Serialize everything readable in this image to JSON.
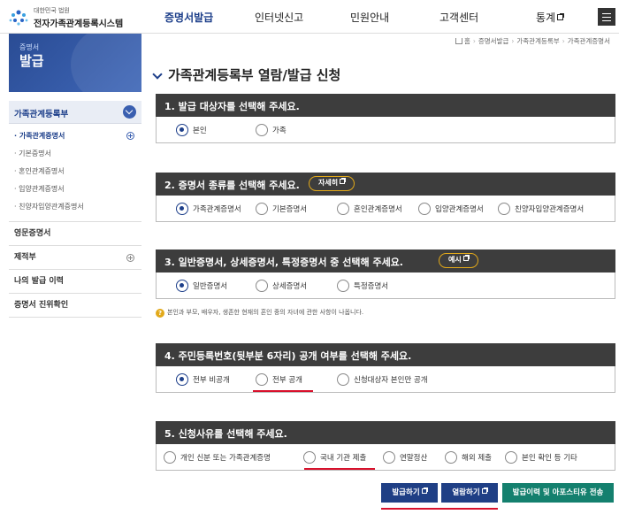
{
  "header": {
    "logo_sub": "대한민국 법원",
    "logo_main": "전자가족관계등록시스템",
    "logo_icon": "court-emblem-icon",
    "nav": [
      {
        "label": "증명서발급",
        "active": true,
        "external": false
      },
      {
        "label": "인터넷신고",
        "active": false,
        "external": false
      },
      {
        "label": "민원안내",
        "active": false,
        "external": false
      },
      {
        "label": "고객센터",
        "active": false,
        "external": false
      },
      {
        "label": "통계",
        "active": false,
        "external": true
      }
    ],
    "menu_icon": "hamburger-icon"
  },
  "sidebar": {
    "banner_small": "증명서",
    "banner_big": "발급",
    "section_title": "가족관계등록부",
    "sub_items": [
      {
        "label": "가족관계증명서",
        "active": true
      },
      {
        "label": "기본증명서",
        "active": false
      },
      {
        "label": "혼인관계증명서",
        "active": false
      },
      {
        "label": "입양관계증명서",
        "active": false
      },
      {
        "label": "친양자입양관계증명서",
        "active": false
      }
    ],
    "menus": [
      {
        "label": "영문증명서",
        "expandable": false
      },
      {
        "label": "제적부",
        "expandable": true
      },
      {
        "label": "나의 발급 이력",
        "expandable": false
      },
      {
        "label": "증명서 진위확인",
        "expandable": false
      }
    ]
  },
  "breadcrumb": [
    "홈",
    "증명서발급",
    "가족관계등록부",
    "가족관계증명서"
  ],
  "page_title": "가족관계등록부 열람/발급 신청",
  "sections": [
    {
      "title": "1. 발급 대상자를 선택해 주세요.",
      "pill": "",
      "options": [
        {
          "label": "본인",
          "checked": true
        },
        {
          "label": "가족",
          "checked": false
        }
      ]
    },
    {
      "title": "2. 증명서 종류를 선택해 주세요.",
      "pill": "자세히",
      "options": [
        {
          "label": "가족관계증명서",
          "checked": true
        },
        {
          "label": "기본증명서",
          "checked": false
        },
        {
          "label": "혼인관계증명서",
          "checked": false
        },
        {
          "label": "입양관계증명서",
          "checked": false
        },
        {
          "label": "친양자입양관계증명서",
          "checked": false
        }
      ]
    },
    {
      "title": "3. 일반증명서, 상세증명서, 특정증명서 중 선택해 주세요.",
      "pill": "예시",
      "options": [
        {
          "label": "일반증명서",
          "checked": true
        },
        {
          "label": "상세증명서",
          "checked": false
        },
        {
          "label": "특정증명서",
          "checked": false
        }
      ]
    },
    {
      "title": "4. 주민등록번호(뒷부분 6자리) 공개 여부를 선택해 주세요.",
      "pill": "",
      "options": [
        {
          "label": "전부 비공개",
          "checked": true
        },
        {
          "label": "전부 공개",
          "checked": false
        },
        {
          "label": "신청대상자 본인만 공개",
          "checked": false
        }
      ]
    },
    {
      "title": "5. 신청사유를 선택해 주세요.",
      "pill": "",
      "options": [
        {
          "label": "개인 신분 또는 가족관계증명",
          "checked": false
        },
        {
          "label": "국내 기관 제출",
          "checked": false
        },
        {
          "label": "연말정산",
          "checked": false
        },
        {
          "label": "해외 제출",
          "checked": false
        },
        {
          "label": "본인 확인 등 기타",
          "checked": false
        }
      ]
    }
  ],
  "note": "본인과 부모, 배우자, 생존한 현재의 혼인 중의 자녀에 관한 사항이 나옵니다.",
  "buttons": {
    "issue": "발급하기",
    "view": "열람하기",
    "history": "발급이력 및 아포스티유 전송"
  },
  "colors": {
    "primary": "#1d3f8a",
    "section_header": "#3d3d3d",
    "pill_border": "#e2a91a",
    "annotation_red": "#d8112c",
    "green_button": "#14806e"
  }
}
